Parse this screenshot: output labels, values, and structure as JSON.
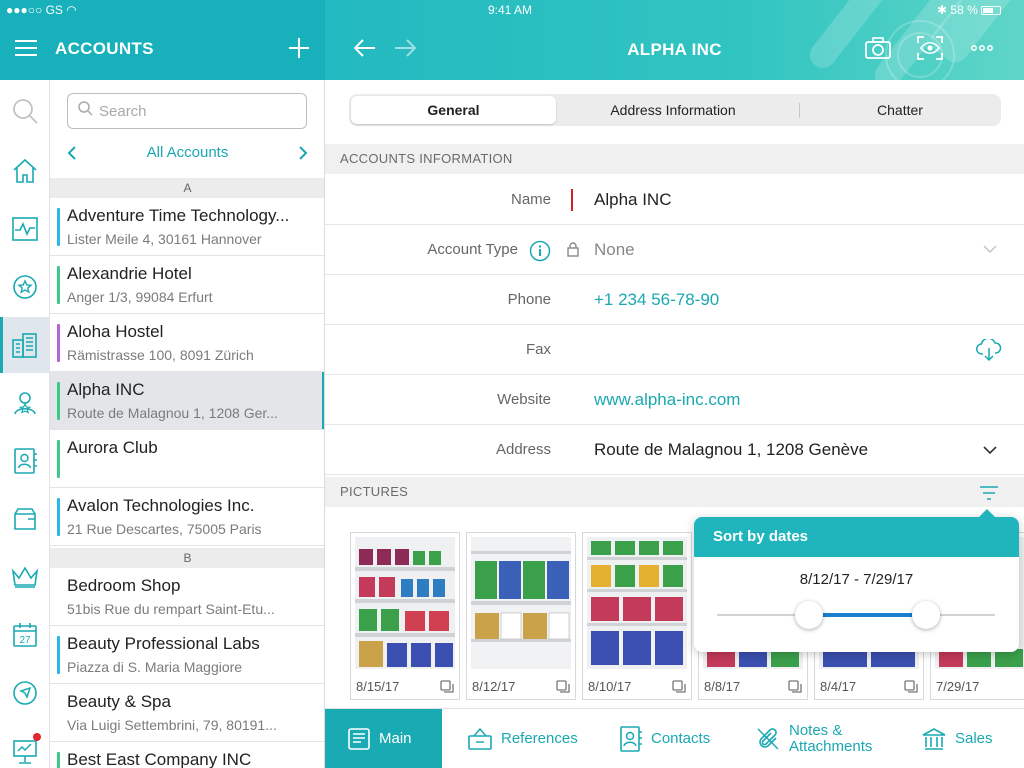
{
  "status_bar": {
    "carrier": "GS",
    "time": "9:41 AM",
    "battery": "58 %"
  },
  "list_header": {
    "title": "ACCOUNTS"
  },
  "detail_header": {
    "title": "ALPHA INC"
  },
  "search": {
    "placeholder": "Search"
  },
  "list_filter": {
    "label": "All Accounts"
  },
  "sections": [
    {
      "letter": "A"
    },
    {
      "letter": "B"
    }
  ],
  "accounts": [
    {
      "name": "Adventure Time Technology...",
      "address": "Lister Meile 4, 30161 Hannover",
      "color": "#29b6e8"
    },
    {
      "name": "Alexandrie Hotel",
      "address": "Anger 1/3, 99084 Erfurt",
      "color": "#3cc98a"
    },
    {
      "name": "Aloha Hostel",
      "address": "Rämistrasse 100, 8091 Zürich",
      "color": "#b464d4"
    },
    {
      "name": "Alpha INC",
      "address": "Route de Malagnou 1, 1208 Ger...",
      "color": "#3cc98a"
    },
    {
      "name": "Aurora Club",
      "address": "",
      "color": "#3cc98a"
    },
    {
      "name": "Avalon Technologies Inc.",
      "address": "21 Rue Descartes, 75005 Paris",
      "color": "#29b6e8"
    },
    {
      "name": "Bedroom Shop",
      "address": "51bis Rue du rempart Saint-Etu...",
      "color": ""
    },
    {
      "name": "Beauty Professional Labs",
      "address": "Piazza di S. Maria Maggiore",
      "color": "#29b6e8"
    },
    {
      "name": "Beauty & Spa",
      "address": "Via Luigi Settembrini, 79, 80191...",
      "color": ""
    },
    {
      "name": "Best East Company INC",
      "address": "",
      "color": "#3cc98a"
    }
  ],
  "tabs": [
    {
      "label": "General"
    },
    {
      "label": "Address Information"
    },
    {
      "label": "Chatter"
    }
  ],
  "accounts_info": {
    "section_title": "ACCOUNTS INFORMATION",
    "name_label": "Name",
    "name_value": "Alpha INC",
    "type_label": "Account Type",
    "type_value": "None",
    "phone_label": "Phone",
    "phone_value": "+1 234 56-78-90",
    "fax_label": "Fax",
    "fax_value": "",
    "website_label": "Website",
    "website_value": "www.alpha-inc.com",
    "address_label": "Address",
    "address_value": "Route de Malagnou 1, 1208 Genève"
  },
  "pictures": {
    "section_title": "PICTURES",
    "items": [
      {
        "date": "8/15/17"
      },
      {
        "date": "8/12/17"
      },
      {
        "date": "8/10/17"
      },
      {
        "date": "8/8/17"
      },
      {
        "date": "8/4/17"
      },
      {
        "date": "7/29/17"
      }
    ]
  },
  "sort_popover": {
    "title": "Sort by dates",
    "range": "8/12/17  -  7/29/17",
    "low_fraction": 0.33,
    "high_fraction": 0.75
  },
  "bottom_tabs": [
    {
      "label": "Main",
      "icon": "document-icon"
    },
    {
      "label": "References",
      "icon": "references-icon"
    },
    {
      "label": "Contacts",
      "icon": "contact-card-icon"
    },
    {
      "label": "Notes &\nAttachments",
      "icon": "paperclip-icon"
    },
    {
      "label": "Sales",
      "icon": "bank-icon"
    }
  ],
  "rail_icons": [
    "search-icon",
    "home-icon",
    "activity-icon",
    "favorites-icon",
    "accounts-icon",
    "leads-icon",
    "contacts-icon",
    "cases-icon",
    "opportunities-icon",
    "calendar-icon",
    "navigate-icon",
    "campaigns-icon"
  ],
  "calendar_day": "27",
  "colors": {
    "accent": "#1aaab3",
    "required": "#d0212b",
    "slider": "#1a7fd1"
  }
}
